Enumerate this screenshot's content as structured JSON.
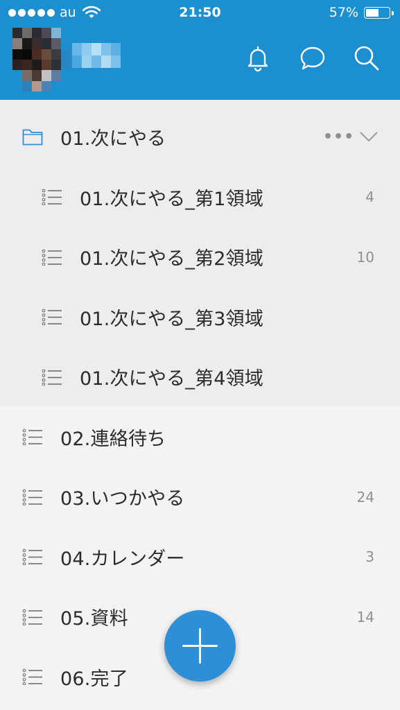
{
  "status_bar": {
    "carrier": "au",
    "time": "21:50",
    "battery_percent": "57%",
    "battery_level": 0.57,
    "signal_dots": 5
  },
  "header": {
    "icons": [
      "bell-icon",
      "chat-bubble-icon",
      "search-icon"
    ],
    "accent_color": "#1b8fd0"
  },
  "folder": {
    "label": "01.次にやる",
    "expanded": true,
    "more_label": "•••",
    "children": [
      {
        "label": "01.次にやる_第1領域",
        "count": "4"
      },
      {
        "label": "01.次にやる_第2領域",
        "count": "10"
      },
      {
        "label": "01.次にやる_第3領域",
        "count": ""
      },
      {
        "label": "01.次にやる_第4領域",
        "count": ""
      }
    ]
  },
  "lists": [
    {
      "label": "02.連絡待ち",
      "count": ""
    },
    {
      "label": "03.いつかやる",
      "count": "24"
    },
    {
      "label": "04.カレンダー",
      "count": "3"
    },
    {
      "label": "05.資料",
      "count": "14"
    },
    {
      "label": "06.完了",
      "count": ""
    }
  ],
  "fab": {
    "icon": "plus-icon",
    "color": "#2e8fd6"
  }
}
